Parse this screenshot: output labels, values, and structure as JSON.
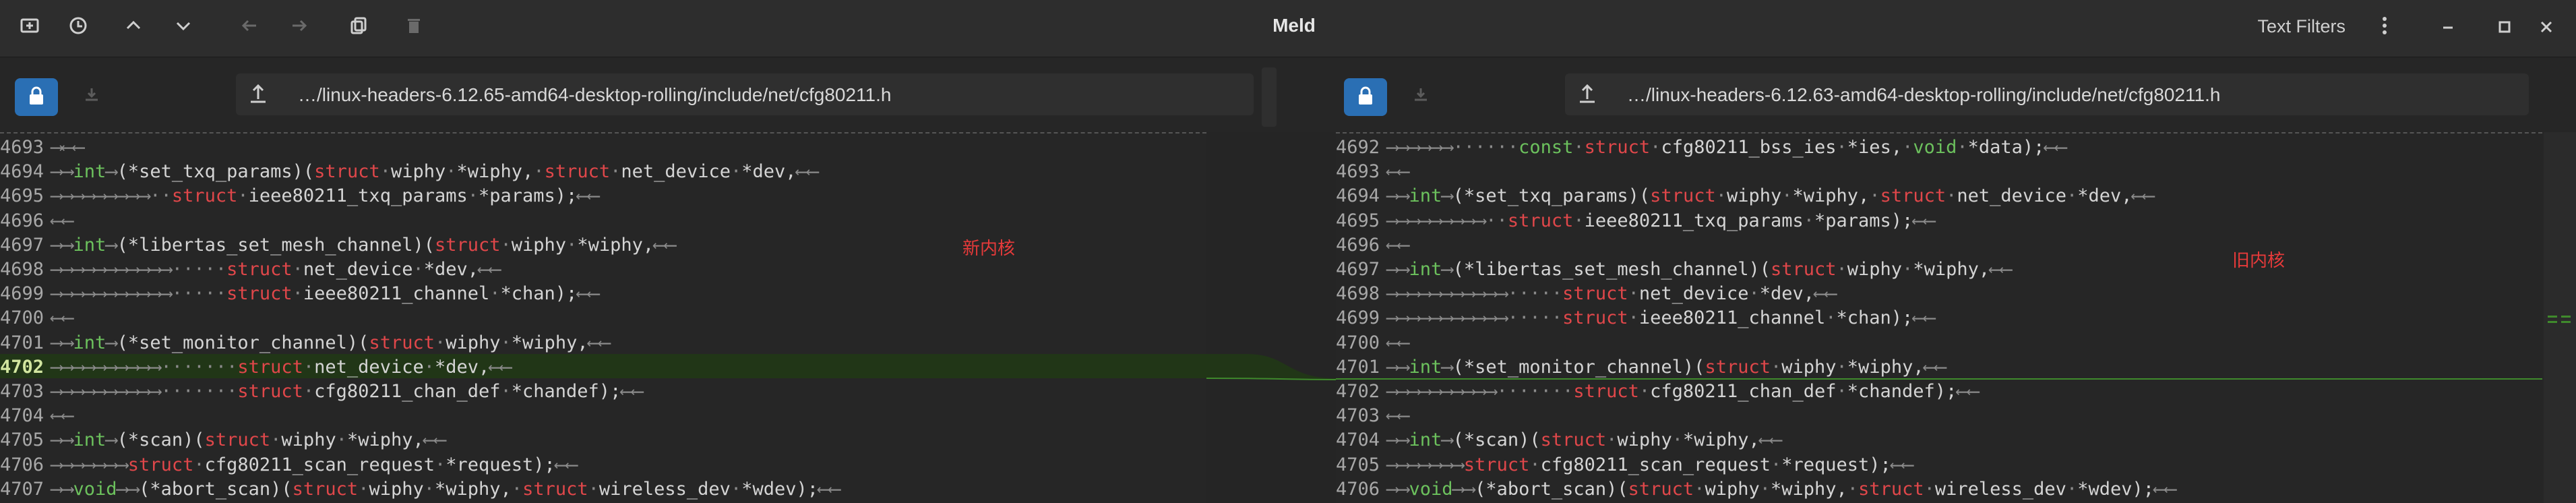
{
  "window": {
    "title": "Meld",
    "text_filters_label": "Text Filters"
  },
  "left": {
    "path": "…/linux-headers-6.12.65-amd64-desktop-rolling/include/net/cfg80211.h",
    "annotation": "新内核",
    "lines": [
      {
        "n": "4693",
        "html": "<span class='ws'>⟶⟵⟵</span>"
      },
      {
        "n": "4694",
        "html": "<span class='ws'>⟶⟶</span><span class='ty'>int</span><span class='ws'>⟶</span>(*set_txq_params)(<span class='kw'>struct</span><span class='ws'>·</span>wiphy<span class='ws'>·</span>*wiphy,<span class='ws'>·</span><span class='kw'>struct</span><span class='ws'>·</span>net_device<span class='ws'>·</span>*dev,<span class='ws'>⟵⟵</span>"
      },
      {
        "n": "4695",
        "html": "<span class='ws'>⟶⟶⟶⟶⟶⟶⟶⟶⟶··</span><span class='kw'>struct</span><span class='ws'>·</span>ieee80211_txq_params<span class='ws'>·</span>*params);<span class='ws'>⟵⟵</span>"
      },
      {
        "n": "4696",
        "html": "<span class='ws'>⟵⟵</span>"
      },
      {
        "n": "4697",
        "html": "<span class='ws'>⟶⟶</span><span class='ty'>int</span><span class='ws'>⟶</span>(*libertas_set_mesh_channel)(<span class='kw'>struct</span><span class='ws'>·</span>wiphy<span class='ws'>·</span>*wiphy,<span class='ws'>⟵⟵</span>"
      },
      {
        "n": "4698",
        "html": "<span class='ws'>⟶⟶⟶⟶⟶⟶⟶⟶⟶⟶⟶·····</span><span class='kw'>struct</span><span class='ws'>·</span>net_device<span class='ws'>·</span>*dev,<span class='ws'>⟵⟵</span>"
      },
      {
        "n": "4699",
        "html": "<span class='ws'>⟶⟶⟶⟶⟶⟶⟶⟶⟶⟶⟶·····</span><span class='kw'>struct</span><span class='ws'>·</span>ieee80211_channel<span class='ws'>·</span>*chan);<span class='ws'>⟵⟵</span>"
      },
      {
        "n": "4700",
        "html": "<span class='ws'>⟵⟵</span>"
      },
      {
        "n": "4701",
        "html": "<span class='ws'>⟶⟶</span><span class='ty'>int</span><span class='ws'>⟶</span>(*set_monitor_channel)(<span class='kw'>struct</span><span class='ws'>·</span>wiphy<span class='ws'>·</span>*wiphy,<span class='ws'>⟵⟵</span>"
      },
      {
        "n": "4702",
        "cur": true,
        "html": "<span class='ws'>⟶⟶⟶⟶⟶⟶⟶⟶⟶⟶·······</span><span class='kw'>struct</span><span class='ws'>·</span>net_device<span class='ws'>·</span>*dev,<span class='ws'>⟵⟵</span>"
      },
      {
        "n": "4703",
        "html": "<span class='ws'>⟶⟶⟶⟶⟶⟶⟶⟶⟶⟶·······</span><span class='kw'>struct</span><span class='ws'>·</span>cfg80211_chan_def<span class='ws'>·</span>*chandef);<span class='ws'>⟵⟵</span>"
      },
      {
        "n": "4704",
        "html": "<span class='ws'>⟵⟵</span>"
      },
      {
        "n": "4705",
        "html": "<span class='ws'>⟶⟶</span><span class='ty'>int</span><span class='ws'>⟶</span>(*scan)(<span class='kw'>struct</span><span class='ws'>·</span>wiphy<span class='ws'>·</span>*wiphy,<span class='ws'>⟵⟵</span>"
      },
      {
        "n": "4706",
        "html": "<span class='ws'>⟶⟶⟶⟶⟶⟶⟶</span><span class='kw'>struct</span><span class='ws'>·</span>cfg80211_scan_request<span class='ws'>·</span>*request);<span class='ws'>⟵⟵</span>"
      },
      {
        "n": "4707",
        "html": "<span class='ws'>⟶⟶</span><span class='ty'>void</span><span class='ws'>⟶⟶</span>(*abort_scan)(<span class='kw'>struct</span><span class='ws'>·</span>wiphy<span class='ws'>·</span>*wiphy,<span class='ws'>·</span><span class='kw'>struct</span><span class='ws'>·</span>wireless_dev<span class='ws'>·</span>*wdev);<span class='ws'>⟵⟵</span>"
      }
    ]
  },
  "right": {
    "path": "…/linux-headers-6.12.63-amd64-desktop-rolling/include/net/cfg80211.h",
    "annotation": "旧内核",
    "lines": [
      {
        "n": "4692",
        "html": "<span class='ws'>⟶⟶⟶⟶⟶⟶······</span><span class='ty'>const</span><span class='ws'>·</span><span class='kw'>struct</span><span class='ws'>·</span>cfg80211_bss_ies<span class='ws'>·</span>*ies,<span class='ws'>·</span><span class='ty'>void</span><span class='ws'>·</span>*data);<span class='ws'>⟵⟵</span>"
      },
      {
        "n": "4693",
        "html": "<span class='ws'>⟵⟵</span>"
      },
      {
        "n": "4694",
        "html": "<span class='ws'>⟶⟶</span><span class='ty'>int</span><span class='ws'>⟶</span>(*set_txq_params)(<span class='kw'>struct</span><span class='ws'>·</span>wiphy<span class='ws'>·</span>*wiphy,<span class='ws'>·</span><span class='kw'>struct</span><span class='ws'>·</span>net_device<span class='ws'>·</span>*dev,<span class='ws'>⟵⟵</span>"
      },
      {
        "n": "4695",
        "html": "<span class='ws'>⟶⟶⟶⟶⟶⟶⟶⟶⟶··</span><span class='kw'>struct</span><span class='ws'>·</span>ieee80211_txq_params<span class='ws'>·</span>*params);<span class='ws'>⟵⟵</span>"
      },
      {
        "n": "4696",
        "html": "<span class='ws'>⟵⟵</span>"
      },
      {
        "n": "4697",
        "html": "<span class='ws'>⟶⟶</span><span class='ty'>int</span><span class='ws'>⟶</span>(*libertas_set_mesh_channel)(<span class='kw'>struct</span><span class='ws'>·</span>wiphy<span class='ws'>·</span>*wiphy,<span class='ws'>⟵⟵</span>"
      },
      {
        "n": "4698",
        "html": "<span class='ws'>⟶⟶⟶⟶⟶⟶⟶⟶⟶⟶⟶·····</span><span class='kw'>struct</span><span class='ws'>·</span>net_device<span class='ws'>·</span>*dev,<span class='ws'>⟵⟵</span>"
      },
      {
        "n": "4699",
        "html": "<span class='ws'>⟶⟶⟶⟶⟶⟶⟶⟶⟶⟶⟶·····</span><span class='kw'>struct</span><span class='ws'>·</span>ieee80211_channel<span class='ws'>·</span>*chan);<span class='ws'>⟵⟵</span>"
      },
      {
        "n": "4700",
        "html": "<span class='ws'>⟵⟵</span>"
      },
      {
        "n": "4701",
        "html": "<span class='ws'>⟶⟶</span><span class='ty'>int</span><span class='ws'>⟶</span>(*set_monitor_channel)(<span class='kw'>struct</span><span class='ws'>·</span>wiphy<span class='ws'>·</span>*wiphy,<span class='ws'>⟵⟵</span>"
      },
      {
        "n": "4702",
        "html": "<span class='ws'>⟶⟶⟶⟶⟶⟶⟶⟶⟶⟶·······</span><span class='kw'>struct</span><span class='ws'>·</span>cfg80211_chan_def<span class='ws'>·</span>*chandef);<span class='ws'>⟵⟵</span>"
      },
      {
        "n": "4703",
        "html": "<span class='ws'>⟵⟵</span>"
      },
      {
        "n": "4704",
        "html": "<span class='ws'>⟶⟶</span><span class='ty'>int</span><span class='ws'>⟶</span>(*scan)(<span class='kw'>struct</span><span class='ws'>·</span>wiphy<span class='ws'>·</span>*wiphy,<span class='ws'>⟵⟵</span>"
      },
      {
        "n": "4705",
        "html": "<span class='ws'>⟶⟶⟶⟶⟶⟶⟶</span><span class='kw'>struct</span><span class='ws'>·</span>cfg80211_scan_request<span class='ws'>·</span>*request);<span class='ws'>⟵⟵</span>"
      },
      {
        "n": "4706",
        "html": "<span class='ws'>⟶⟶</span><span class='ty'>void</span><span class='ws'>⟶⟶</span>(*abort_scan)(<span class='kw'>struct</span><span class='ws'>·</span>wiphy<span class='ws'>·</span>*wiphy,<span class='ws'>·</span><span class='kw'>struct</span><span class='ws'>·</span>wireless_dev<span class='ws'>·</span>*wdev);<span class='ws'>⟵⟵</span>"
      }
    ]
  },
  "icons": [
    "new-comparison-icon",
    "history-icon",
    "previous-change-icon",
    "next-change-icon",
    "back-icon",
    "forward-icon",
    "copy-icon",
    "delete-icon",
    "menu-icon",
    "minimize-icon",
    "maximize-icon",
    "close-icon",
    "lock-icon",
    "save-icon",
    "upload-icon"
  ]
}
